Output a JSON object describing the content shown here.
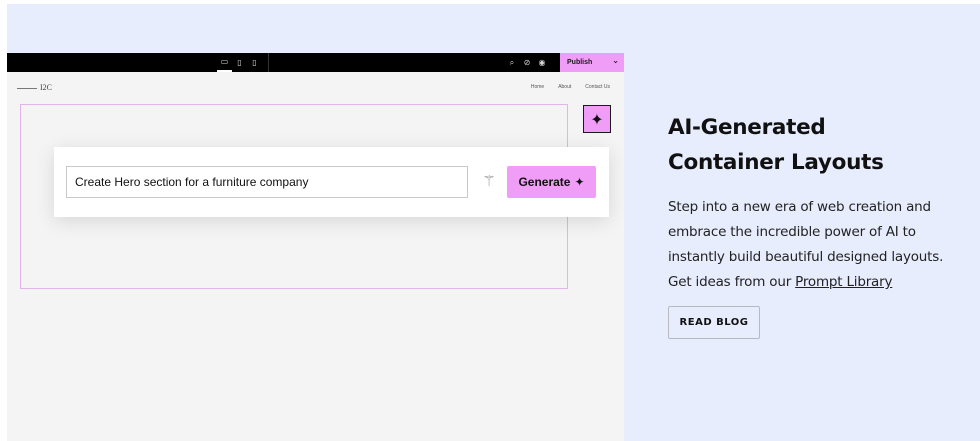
{
  "editor": {
    "device_icons": [
      "▭",
      "▯",
      "▯"
    ],
    "tool_icons": [
      "⌕",
      "⊘",
      "◉"
    ],
    "publish_label": "Publish",
    "publish_chevron": "⌄",
    "site": {
      "logo": "I2C",
      "nav": [
        "Home",
        "About",
        "Contact Us"
      ]
    },
    "ai_badge_icon": "✦",
    "prompt": {
      "value": "Create Hero section for a furniture company",
      "wand_icon": "⚚",
      "generate_label": "Generate",
      "generate_icon": "✦"
    }
  },
  "copy": {
    "heading_line1": "AI-Generated",
    "heading_line2": "Container Layouts",
    "body_prefix": "Step into a new era of web creation and embrace the incredible power of AI to instantly build beautiful designed layouts. Get ideas from our ",
    "body_link": "Prompt Library",
    "read_blog_label": "READ BLOG"
  },
  "colors": {
    "accent_pink": "#ef9df6",
    "panel_background": "#e8edfd",
    "editor_background": "#f4f4f4"
  }
}
